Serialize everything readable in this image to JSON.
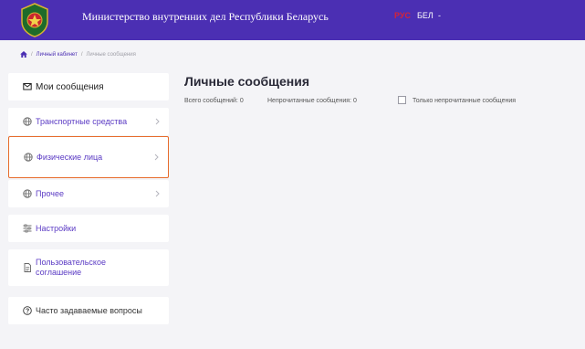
{
  "header": {
    "title": "Министерство внутренних дел Республики Беларусь",
    "languages": [
      "РУС",
      "БЕЛ",
      "-"
    ]
  },
  "breadcrumb": {
    "home_icon": "home-icon",
    "items": [
      "Личный кабинет",
      "Личные сообщения"
    ]
  },
  "sidebar": {
    "items": [
      {
        "label": "Мои сообщения",
        "icon": "message-icon"
      },
      {
        "label": "Транспортные средства",
        "icon": "globe-icon",
        "has_chevron": true
      },
      {
        "label": "Физические лица",
        "icon": "globe-icon",
        "has_chevron": true,
        "highlighted": true
      },
      {
        "label": "Прочее",
        "icon": "globe-icon",
        "has_chevron": true
      },
      {
        "label": "Настройки",
        "icon": "sliders-icon"
      },
      {
        "label": "Пользовательское соглашение",
        "icon": "document-icon"
      },
      {
        "label": "Часто задаваемые вопросы",
        "icon": "question-icon"
      }
    ]
  },
  "main": {
    "title": "Личные сообщения",
    "total_messages": "Всего сообщений: 0",
    "unread_messages": "Непрочитанные сообщения: 0",
    "unread_only_label": "Только непрочитанные сообщения",
    "unread_only_checked": false
  },
  "colors": {
    "header_bg": "#4b2fb3",
    "accent": "#5b3bc4",
    "active_lang": "#d4233a",
    "highlight_border": "#e76b2b"
  }
}
